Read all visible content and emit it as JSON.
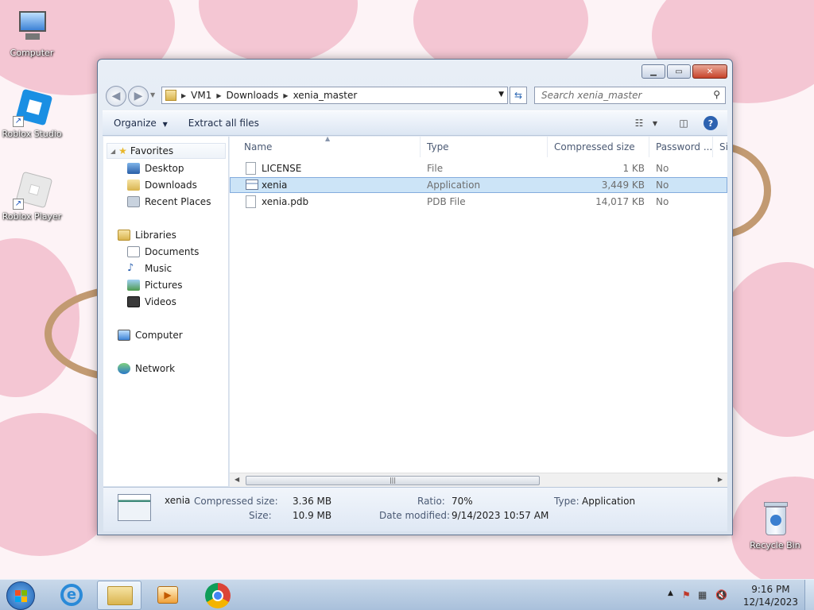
{
  "desktop": {
    "icons": [
      {
        "label": "Computer"
      },
      {
        "label": "Roblox Studio"
      },
      {
        "label": "Roblox Player"
      },
      {
        "label": "Recycle Bin"
      }
    ]
  },
  "window": {
    "breadcrumb": [
      "VM1",
      "Downloads",
      "xenia_master"
    ],
    "search_placeholder": "Search xenia_master",
    "toolbar": {
      "organize": "Organize",
      "extract": "Extract all files"
    },
    "nav": {
      "favorites": "Favorites",
      "desktop": "Desktop",
      "downloads": "Downloads",
      "recent": "Recent Places",
      "libraries": "Libraries",
      "documents": "Documents",
      "music": "Music",
      "pictures": "Pictures",
      "videos": "Videos",
      "computer": "Computer",
      "network": "Network"
    },
    "columns": {
      "name": "Name",
      "type": "Type",
      "compressed": "Compressed size",
      "password": "Password ...",
      "size": "Si"
    },
    "files": [
      {
        "name": "LICENSE",
        "type": "File",
        "compressed": "1 KB",
        "password": "No"
      },
      {
        "name": "xenia",
        "type": "Application",
        "compressed": "3,449 KB",
        "password": "No"
      },
      {
        "name": "xenia.pdb",
        "type": "PDB File",
        "compressed": "14,017 KB",
        "password": "No"
      }
    ],
    "details": {
      "name": "xenia",
      "compressed_label": "Compressed size:",
      "compressed_value": "3.36 MB",
      "size_label": "Size:",
      "size_value": "10.9 MB",
      "ratio_label": "Ratio:",
      "ratio_value": "70%",
      "modified_label": "Date modified:",
      "modified_value": "9/14/2023 10:57 AM",
      "type_label": "Type:",
      "type_value": "Application"
    }
  },
  "taskbar": {
    "time": "9:16 PM",
    "date": "12/14/2023"
  },
  "colors": {
    "selection": "#cce4f7",
    "wallpaper_pink": "#f4c6d3",
    "ring_brown": "#c29a72"
  }
}
